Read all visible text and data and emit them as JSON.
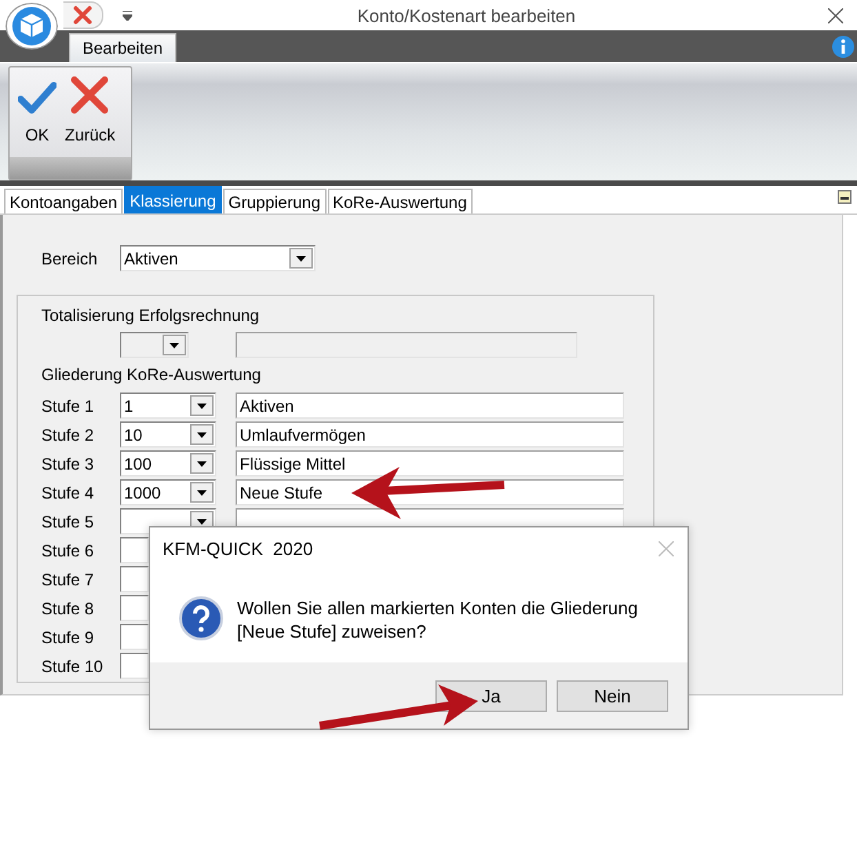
{
  "window": {
    "title": "Konto/Kostenart bearbeiten"
  },
  "ribbon": {
    "tab": "Bearbeiten",
    "buttons": [
      {
        "label": "OK",
        "kind": "check"
      },
      {
        "label": "Zurück",
        "kind": "cross"
      }
    ]
  },
  "tabs": [
    {
      "label": "Kontoangaben",
      "selected": false
    },
    {
      "label": "Klassierung",
      "selected": true
    },
    {
      "label": "Gruppierung",
      "selected": false
    },
    {
      "label": "KoRe-Auswertung",
      "selected": false
    }
  ],
  "bereich": {
    "label": "Bereich",
    "value": "Aktiven"
  },
  "group": {
    "totalisierung_label": "Totalisierung Erfolgsrechnung",
    "gliederung_label": "Gliederung KoRe-Auswertung",
    "levels": [
      {
        "label": "Stufe 1",
        "code": "1",
        "name": "Aktiven"
      },
      {
        "label": "Stufe 2",
        "code": "10",
        "name": "Umlaufvermögen"
      },
      {
        "label": "Stufe 3",
        "code": "100",
        "name": "Flüssige Mittel"
      },
      {
        "label": "Stufe 4",
        "code": "1000",
        "name": "Neue Stufe"
      },
      {
        "label": "Stufe 5"
      },
      {
        "label": "Stufe 6"
      },
      {
        "label": "Stufe 7"
      },
      {
        "label": "Stufe 8"
      },
      {
        "label": "Stufe 9"
      },
      {
        "label": "Stufe 10"
      }
    ]
  },
  "dialog": {
    "title": "KFM-QUICK  2020",
    "message": "Wollen Sie allen markierten Konten die Gliederung [Neue Stufe] zuweisen?",
    "buttons": [
      {
        "label": "Ja"
      },
      {
        "label": "Nein"
      }
    ]
  }
}
